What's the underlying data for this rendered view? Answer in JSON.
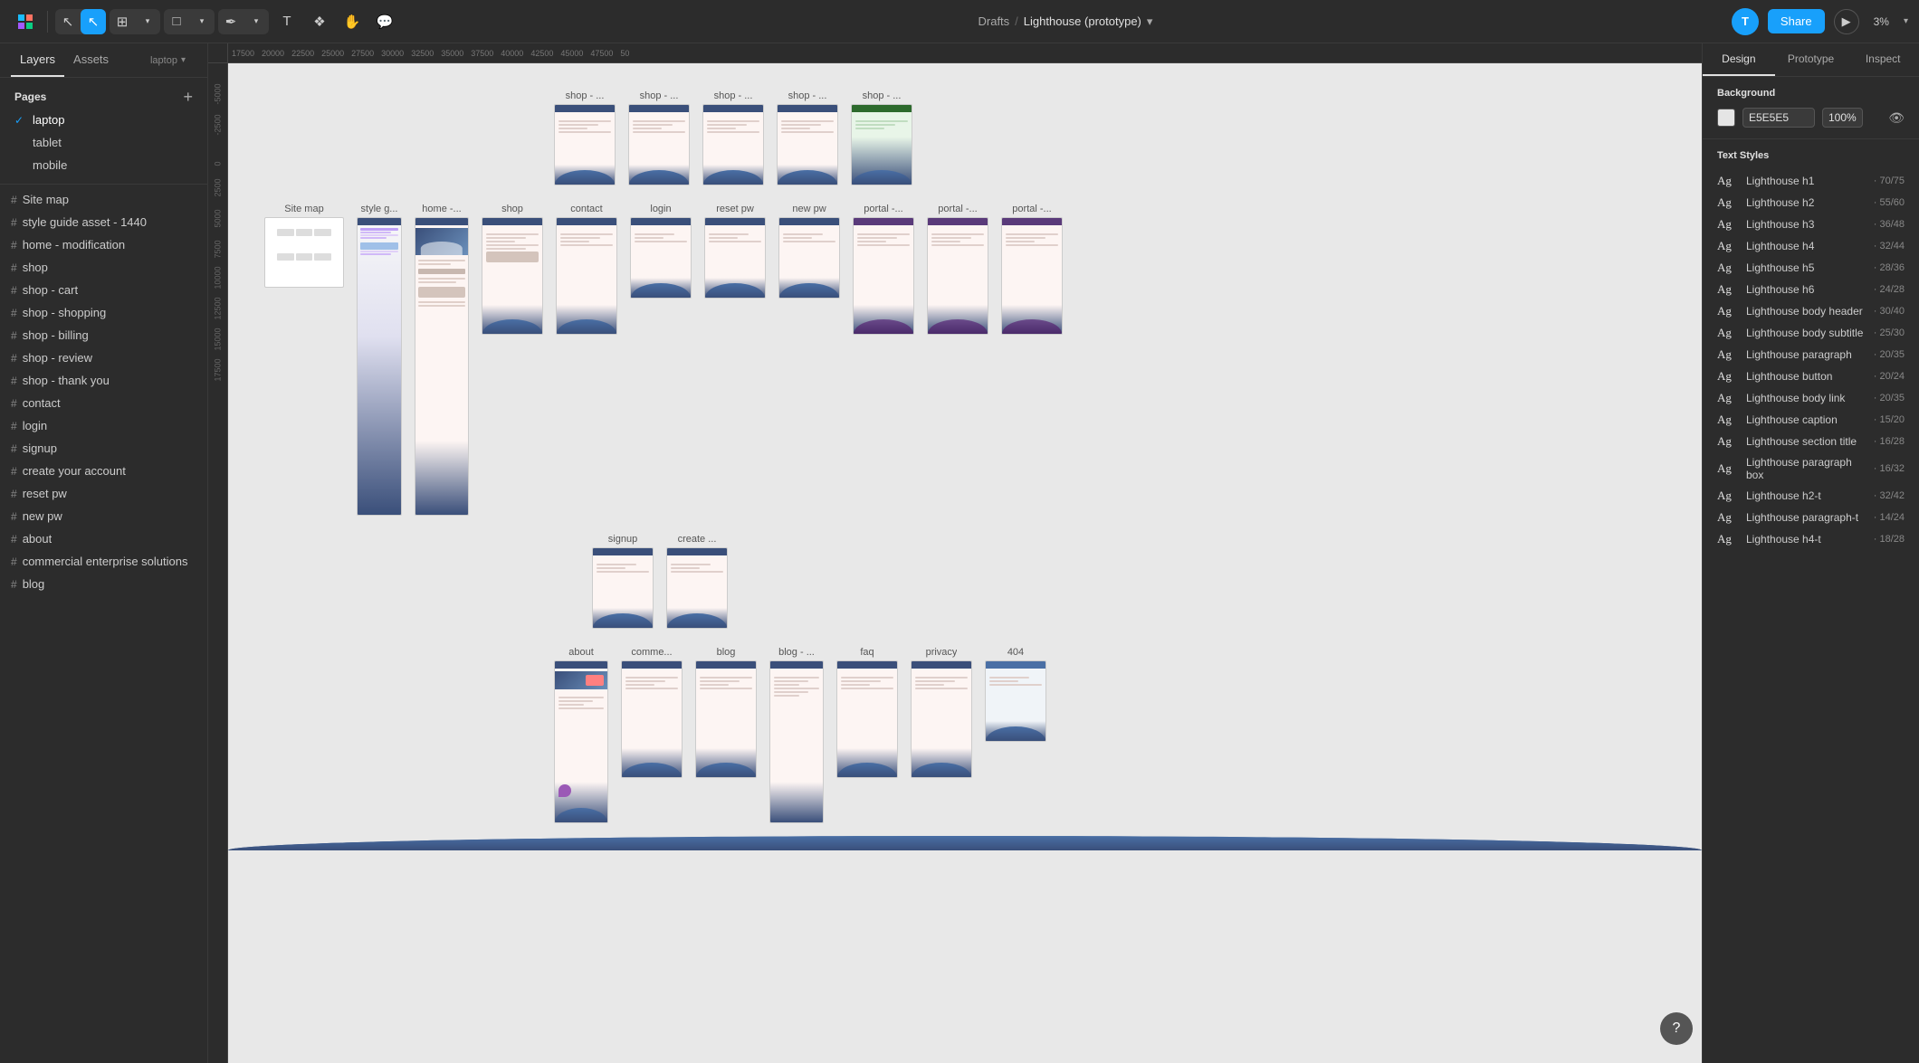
{
  "app": {
    "title": "Lighthouse (prototype)",
    "breadcrumb": "Drafts",
    "zoom": "3%"
  },
  "toolbar": {
    "tools": [
      {
        "id": "select",
        "label": "Select",
        "icon": "⊹",
        "active": false
      },
      {
        "id": "move",
        "label": "Move",
        "icon": "↖",
        "active": true
      },
      {
        "id": "frame",
        "label": "Frame",
        "icon": "⊞",
        "active": false
      },
      {
        "id": "shape",
        "label": "Shape",
        "icon": "□",
        "active": false
      },
      {
        "id": "pen",
        "label": "Pen",
        "icon": "✒",
        "active": false
      },
      {
        "id": "text",
        "label": "Text",
        "icon": "T",
        "active": false
      },
      {
        "id": "components",
        "label": "Components",
        "icon": "❖",
        "active": false
      },
      {
        "id": "hand",
        "label": "Hand",
        "icon": "✋",
        "active": false
      },
      {
        "id": "comment",
        "label": "Comment",
        "icon": "💬",
        "active": false
      }
    ],
    "share_label": "Share",
    "zoom_label": "3%"
  },
  "left_panel": {
    "tabs": [
      "Layers",
      "Assets"
    ],
    "panel_label": "laptop",
    "pages": {
      "title": "Pages",
      "items": [
        {
          "label": "laptop",
          "active": true
        },
        {
          "label": "tablet",
          "active": false
        },
        {
          "label": "mobile",
          "active": false
        }
      ]
    },
    "layers": [
      {
        "label": "Site map"
      },
      {
        "label": "style guide asset - 1440"
      },
      {
        "label": "home - modification"
      },
      {
        "label": "shop"
      },
      {
        "label": "shop - cart"
      },
      {
        "label": "shop - shopping"
      },
      {
        "label": "shop - billing"
      },
      {
        "label": "shop - review"
      },
      {
        "label": "shop - thank you"
      },
      {
        "label": "contact"
      },
      {
        "label": "login"
      },
      {
        "label": "signup"
      },
      {
        "label": "create your account"
      },
      {
        "label": "reset pw"
      },
      {
        "label": "new pw"
      },
      {
        "label": "about"
      },
      {
        "label": "commercial enterprise solutions"
      },
      {
        "label": "blog"
      }
    ]
  },
  "right_panel": {
    "tabs": [
      "Design",
      "Prototype",
      "Inspect"
    ],
    "active_tab": "Design",
    "background": {
      "title": "Background",
      "color": "E5E5E5",
      "opacity": "100%"
    },
    "text_styles": {
      "title": "Text Styles",
      "items": [
        {
          "label": "Lighthouse h1",
          "detail": "70/75"
        },
        {
          "label": "Lighthouse h2",
          "detail": "55/60"
        },
        {
          "label": "Lighthouse h3",
          "detail": "36/48"
        },
        {
          "label": "Lighthouse h4",
          "detail": "32/44"
        },
        {
          "label": "Lighthouse h5",
          "detail": "28/36"
        },
        {
          "label": "Lighthouse h6",
          "detail": "24/28"
        },
        {
          "label": "Lighthouse body header",
          "detail": "30/40"
        },
        {
          "label": "Lighthouse body subtitle",
          "detail": "25/30"
        },
        {
          "label": "Lighthouse paragraph",
          "detail": "20/35"
        },
        {
          "label": "Lighthouse button",
          "detail": "20/24"
        },
        {
          "label": "Lighthouse body link",
          "detail": "20/35"
        },
        {
          "label": "Lighthouse caption",
          "detail": "15/20"
        },
        {
          "label": "Lighthouse section title",
          "detail": "16/28"
        },
        {
          "label": "Lighthouse paragraph box",
          "detail": "16/32"
        },
        {
          "label": "Lighthouse h2-t",
          "detail": "32/42"
        },
        {
          "label": "Lighthouse paragraph-t",
          "detail": "14/24"
        },
        {
          "label": "Lighthouse h4-t",
          "detail": "18/28"
        }
      ]
    }
  },
  "canvas": {
    "ruler_nums_top": [
      "17500",
      "20000",
      "22500",
      "25000",
      "27500",
      "30000",
      "32500",
      "35000",
      "37500",
      "40000",
      "42500",
      "45000",
      "47500",
      "50"
    ],
    "ruler_nums_left": [
      "-5000",
      "-2500",
      "0",
      "2500",
      "5000",
      "7500",
      "10000",
      "12500",
      "15000",
      "17500"
    ],
    "frames_row1": [
      {
        "label": "shop - ...",
        "type": "sm"
      },
      {
        "label": "shop - ...",
        "type": "sm"
      },
      {
        "label": "shop - ...",
        "type": "sm"
      },
      {
        "label": "shop - ...",
        "type": "sm"
      },
      {
        "label": "shop - ...",
        "type": "sm"
      }
    ],
    "frames_row2": [
      {
        "label": "Site map",
        "type": "sitemap"
      },
      {
        "label": "style g...",
        "type": "style"
      },
      {
        "label": "home -...",
        "type": "lg"
      },
      {
        "label": "shop",
        "type": "md"
      },
      {
        "label": "contact",
        "type": "md"
      },
      {
        "label": "login",
        "type": "sm"
      },
      {
        "label": "reset pw",
        "type": "sm"
      },
      {
        "label": "new pw",
        "type": "sm"
      },
      {
        "label": "portal -...",
        "type": "md"
      },
      {
        "label": "portal -...",
        "type": "md"
      },
      {
        "label": "portal -...",
        "type": "md"
      }
    ],
    "frames_row2b": [
      {
        "label": "signup",
        "type": "sm"
      },
      {
        "label": "create ...",
        "type": "sm"
      }
    ],
    "frames_row3": [
      {
        "label": "about",
        "type": "lg"
      },
      {
        "label": "comme...",
        "type": "md"
      },
      {
        "label": "blog",
        "type": "md"
      },
      {
        "label": "blog - ...",
        "type": "lg"
      },
      {
        "label": "faq",
        "type": "md"
      },
      {
        "label": "privacy",
        "type": "md"
      },
      {
        "label": "404",
        "type": "sm"
      }
    ]
  }
}
